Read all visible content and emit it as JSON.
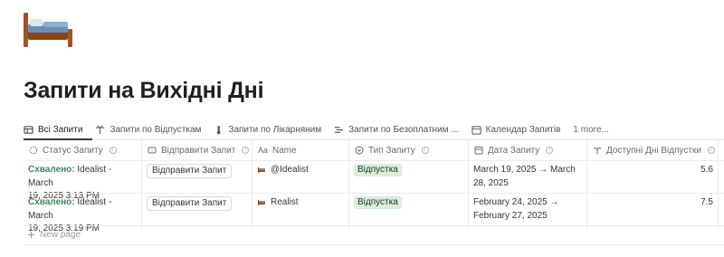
{
  "page": {
    "icon": "bed-icon",
    "title": "Запити на Вихідні Дні"
  },
  "views": {
    "tabs": [
      {
        "label": "Всі Запити",
        "icon": "table-icon",
        "active": true
      },
      {
        "label": "Запити по Відпусткам",
        "icon": "palm-tree-icon"
      },
      {
        "label": "Запити по Лікарняним",
        "icon": "thermometer-icon"
      },
      {
        "label": "Запити по Безоплатним ...",
        "icon": "list-icon"
      },
      {
        "label": "Календар Запитів",
        "icon": "calendar-icon"
      }
    ],
    "more": "1 more..."
  },
  "table": {
    "columns": [
      {
        "label": "Статус Запиту",
        "icon": "status-icon",
        "info": true
      },
      {
        "label": "Відправити Запит",
        "icon": "button-icon",
        "info": true
      },
      {
        "label": "Name",
        "icon": "text-aa-icon",
        "info": false
      },
      {
        "label": "Тип Запиту",
        "icon": "select-icon",
        "info": true
      },
      {
        "label": "Дата Запиту",
        "icon": "calendar-icon",
        "info": true
      },
      {
        "label": "Доступні Дні Відпустки",
        "icon": "palm-tree-icon",
        "info": true
      }
    ],
    "rows": [
      {
        "status_prefix": "Схвалено:",
        "status_rest": " Idealist - March 19, 2025 3:13 PM",
        "status_line1_rest": " Idealist - March",
        "status_line2": "19, 2025 3:13 PM",
        "button": "Відправити Запит",
        "name": "@Idealist",
        "type": "Відпустка",
        "date_line1": "March 19, 2025 → March",
        "date_line2": "28, 2025",
        "days": "5.6"
      },
      {
        "status_prefix": "Схвалено:",
        "status_line1_rest": " Idealist - March",
        "status_line2": "19, 2025 3:19 PM",
        "button": "Відправити Запит",
        "name": "Realist",
        "type": "Відпустка",
        "date_line1": "February 24, 2025 →",
        "date_line2": "February 27, 2025",
        "days": "7.5"
      }
    ],
    "new_page": "New page"
  },
  "colors": {
    "approved": "#448361",
    "tag_bg": "#dbeddb",
    "text": "#37352f"
  }
}
